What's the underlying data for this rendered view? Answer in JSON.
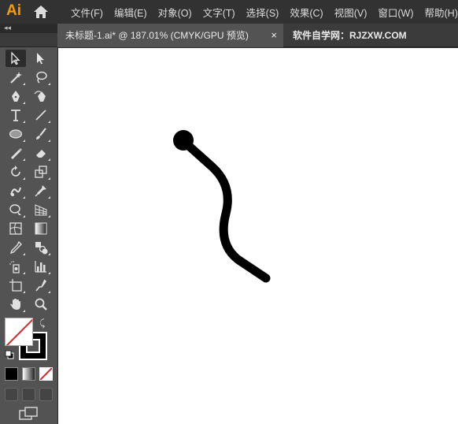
{
  "app": {
    "logo": "Ai"
  },
  "menu": [
    "文件(F)",
    "编辑(E)",
    "对象(O)",
    "文字(T)",
    "选择(S)",
    "效果(C)",
    "视图(V)",
    "窗口(W)",
    "帮助(H)"
  ],
  "tabs": {
    "collapse_label": "◂◂",
    "active_title": "未标题-1.ai* @ 187.01% (CMYK/GPU 预览)",
    "close_label": "×",
    "other_title": "软件自学网：RJZXW.COM"
  },
  "tools": [
    "selection-tool",
    "direct-selection-tool",
    "magic-wand-tool",
    "lasso-tool",
    "pen-tool",
    "curvature-tool",
    "type-tool",
    "line-segment-tool",
    "ellipse-tool",
    "paintbrush-tool",
    "shaper-tool",
    "eraser-tool",
    "rotate-tool",
    "scale-tool",
    "warp-tool",
    "puppet-warp-tool",
    "shape-builder-tool",
    "perspective-grid-tool",
    "mesh-tool",
    "gradient-tool",
    "eyedropper-tool",
    "blend-tool",
    "symbol-sprayer-tool",
    "column-graph-tool",
    "artboard-tool",
    "slice-tool",
    "hand-tool",
    "zoom-tool"
  ],
  "colors": {
    "panel": "#535353",
    "menubar": "#323232",
    "accent": "#ff9a00",
    "canvas": "#ffffff",
    "stroke": "#000000"
  }
}
